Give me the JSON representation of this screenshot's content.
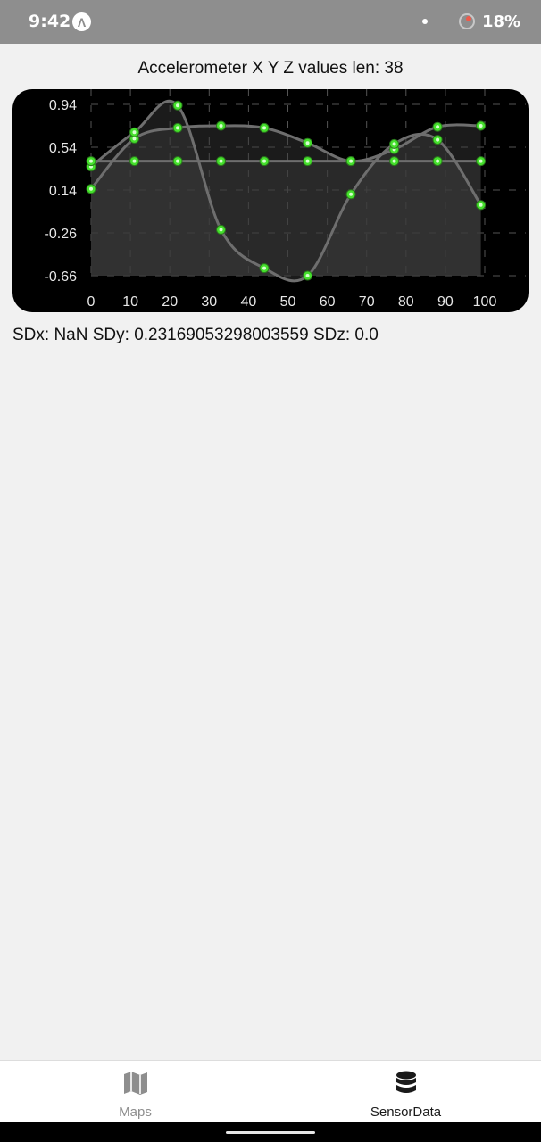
{
  "status_bar": {
    "time": "9:42",
    "app_icon_glyph": "Λ",
    "app_icon_name": "expo-icon",
    "battery": "18%"
  },
  "main": {
    "title": "Accelerometer X Y Z values len: 38",
    "stats": "SDx: NaN SDy: 0.23169053298003559 SDz: 0.0"
  },
  "chart_data": {
    "type": "line",
    "x": [
      0,
      11,
      22,
      33,
      44,
      55,
      66,
      77,
      88,
      99
    ],
    "x_ticks": [
      "0",
      "10",
      "20",
      "30",
      "40",
      "50",
      "60",
      "70",
      "80",
      "90",
      "100"
    ],
    "y_ticks": [
      "0.94",
      "0.54",
      "0.14",
      "-0.26",
      "-0.66"
    ],
    "ylim": [
      -0.66,
      0.94
    ],
    "grid": true,
    "series": [
      {
        "values": [
          0.15,
          0.62,
          0.72,
          0.74,
          0.72,
          0.58,
          0.41,
          0.52,
          0.73,
          0.74
        ]
      },
      {
        "values": [
          0.36,
          0.68,
          0.93,
          -0.23,
          -0.59,
          -0.66,
          0.1,
          0.57,
          0.61,
          0.0
        ]
      },
      {
        "values": [
          0.41,
          0.41,
          0.41,
          0.41,
          0.41,
          0.41,
          0.41,
          0.41,
          0.41,
          0.41
        ]
      }
    ],
    "point_color": "#45e02c",
    "line_color": "#6e6e6e",
    "fill_color": "#3c3c3c"
  },
  "tabs": [
    {
      "label": "Maps",
      "icon": "map-icon"
    },
    {
      "label": "SensorData",
      "icon": "database-icon"
    }
  ]
}
